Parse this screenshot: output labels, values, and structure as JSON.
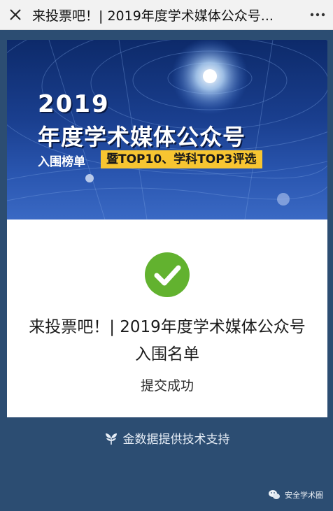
{
  "topbar": {
    "title": "来投票吧！| 2019年度学术媒体公众号...",
    "close_icon": "close-icon",
    "more_icon": "more-icon"
  },
  "banner": {
    "year": "2019",
    "title": "年度学术媒体公众号",
    "label": "入围榜单",
    "tag": "暨TOP10、学科TOP3评选"
  },
  "result": {
    "icon": "check-circle-icon",
    "icon_color": "#62b22f",
    "message": "来投票吧！| 2019年度学术媒体公众号入围名单",
    "status": "提交成功"
  },
  "footer": {
    "text": "金数据提供技术支持",
    "icon": "leaf-icon"
  },
  "watermark": {
    "text": "安全学术圈",
    "icon": "wechat-icon"
  },
  "colors": {
    "background": "#2c4d72",
    "topbar": "#f2f2f2",
    "tag": "#f7c531"
  }
}
